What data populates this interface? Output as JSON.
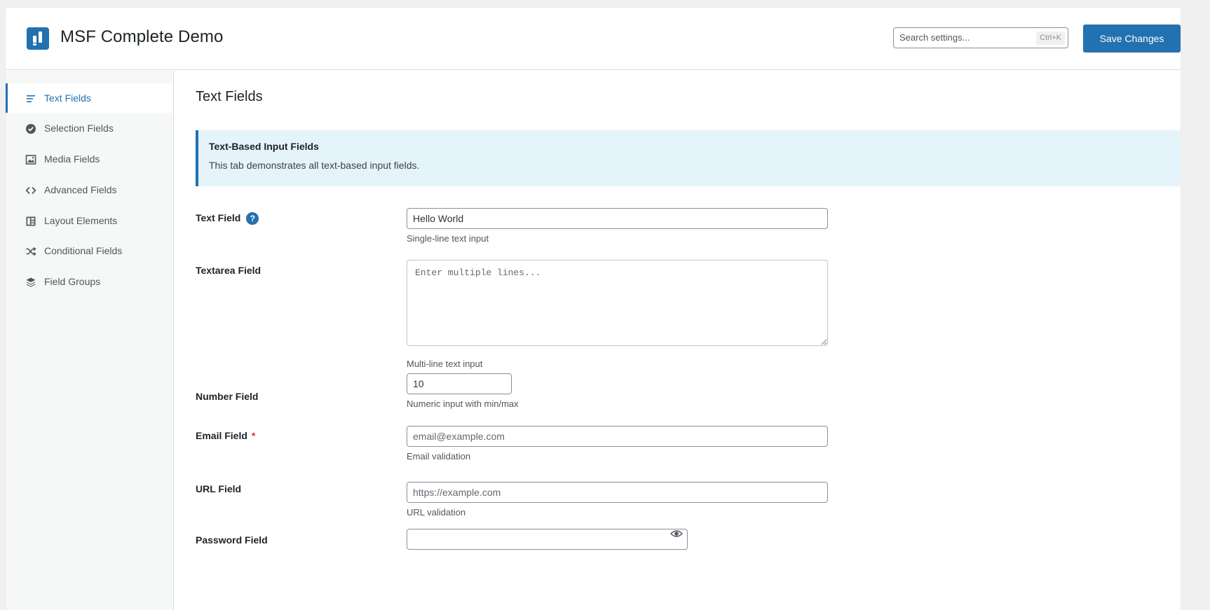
{
  "header": {
    "app_title": "MSF Complete Demo",
    "search_placeholder": "Search settings...",
    "search_shortcut": "Ctrl+K",
    "save_label": "Save Changes"
  },
  "sidebar": {
    "items": [
      {
        "label": "Text Fields",
        "icon": "text-lines-icon",
        "active": true
      },
      {
        "label": "Selection Fields",
        "icon": "check-circle-icon",
        "active": false
      },
      {
        "label": "Media Fields",
        "icon": "image-icon",
        "active": false
      },
      {
        "label": "Advanced Fields",
        "icon": "code-icon",
        "active": false
      },
      {
        "label": "Layout Elements",
        "icon": "layout-icon",
        "active": false
      },
      {
        "label": "Conditional Fields",
        "icon": "shuffle-icon",
        "active": false
      },
      {
        "label": "Field Groups",
        "icon": "layers-icon",
        "active": false
      }
    ]
  },
  "main": {
    "title": "Text Fields",
    "notice": {
      "title": "Text-Based Input Fields",
      "text": "This tab demonstrates all text-based input fields."
    },
    "fields": {
      "text": {
        "label": "Text Field",
        "value": "Hello World",
        "desc": "Single-line text input",
        "help": "?"
      },
      "textarea": {
        "label": "Textarea Field",
        "placeholder": "Enter multiple lines...",
        "desc": "Multi-line text input"
      },
      "number": {
        "label": "Number Field",
        "value": "10",
        "desc": "Numeric input with min/max"
      },
      "email": {
        "label": "Email Field",
        "required_mark": "*",
        "placeholder": "email@example.com",
        "desc": "Email validation"
      },
      "url": {
        "label": "URL Field",
        "placeholder": "https://example.com",
        "desc": "URL validation"
      },
      "password": {
        "label": "Password Field",
        "value": ""
      }
    }
  },
  "colors": {
    "accent": "#2271b1",
    "notice_bg": "#e5f3fb",
    "required": "#d63638"
  }
}
